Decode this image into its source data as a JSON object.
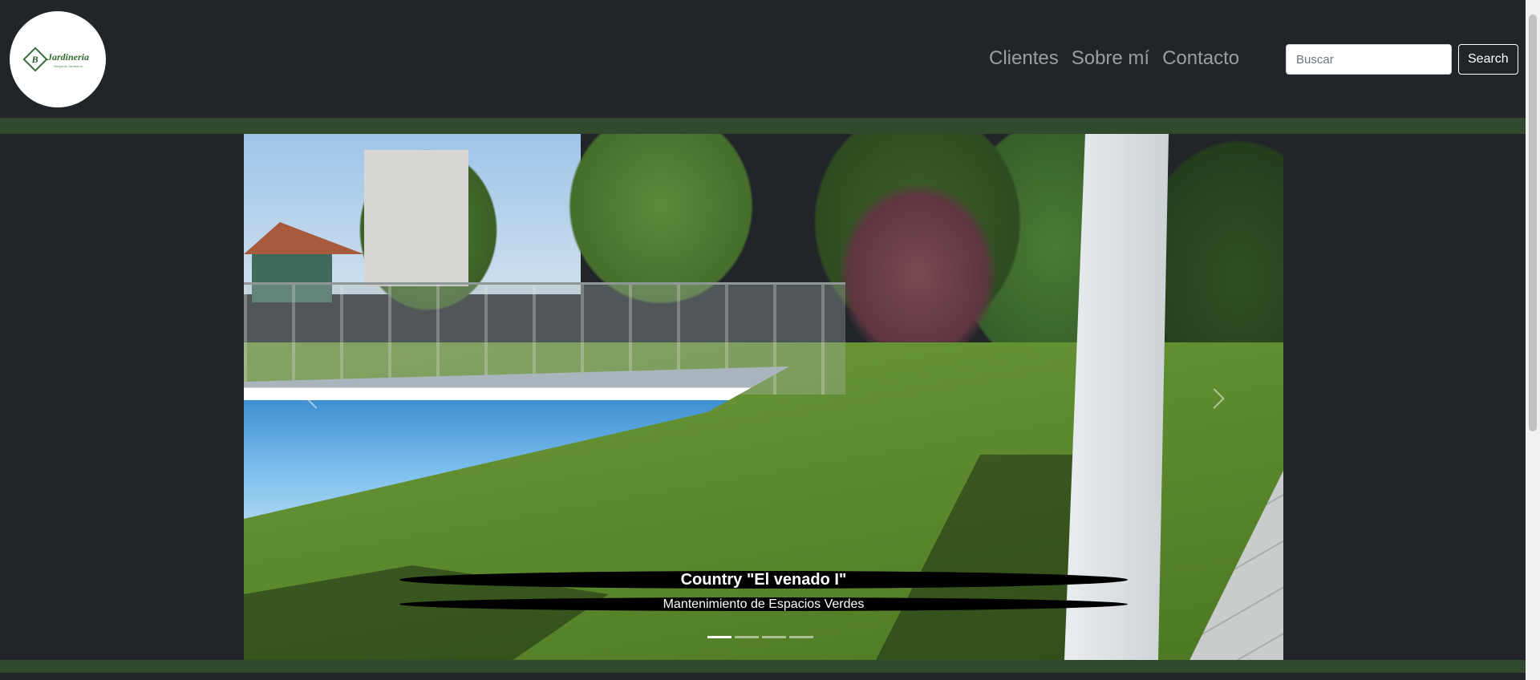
{
  "brand": {
    "logo_title": "Jardineria",
    "logo_mark": "B",
    "logo_sub": "Benjamin Jardinería"
  },
  "nav": {
    "links": [
      "Clientes",
      "Sobre mí",
      "Contacto"
    ]
  },
  "search": {
    "placeholder": "Buscar",
    "button_label": "Search"
  },
  "carousel": {
    "caption_title": "Country \"El venado I\"",
    "caption_subtitle": "Mantenimiento de Espacios Verdes",
    "slide_count": 4,
    "active_slide": 1,
    "prev_icon": "chevron-left-icon",
    "next_icon": "chevron-right-icon"
  },
  "colors": {
    "background": "#212529",
    "band": "#2f4a2d",
    "nav_link": "rgba(255,255,255,0.55)"
  }
}
